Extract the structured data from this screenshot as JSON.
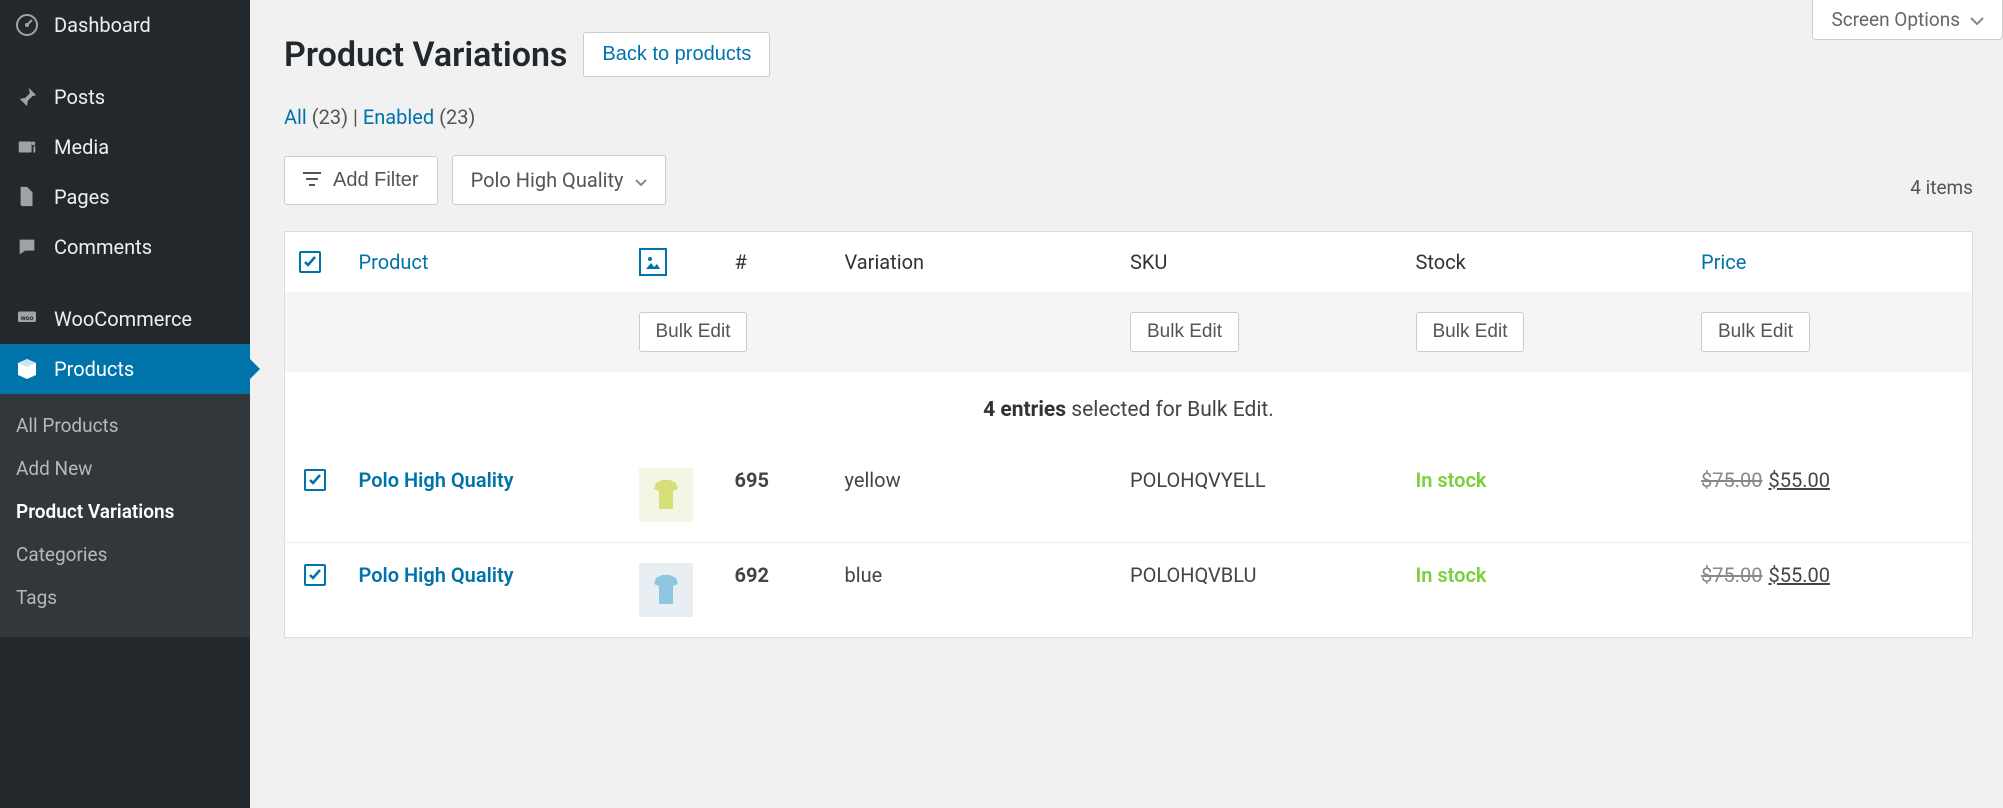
{
  "sidebar": {
    "items": [
      {
        "icon": "dashboard",
        "label": "Dashboard"
      },
      {
        "icon": "pin",
        "label": "Posts"
      },
      {
        "icon": "media",
        "label": "Media"
      },
      {
        "icon": "page",
        "label": "Pages"
      },
      {
        "icon": "comment",
        "label": "Comments"
      },
      {
        "icon": "woo",
        "label": "WooCommerce"
      },
      {
        "icon": "product",
        "label": "Products"
      }
    ],
    "submenu": [
      "All Products",
      "Add New",
      "Product Variations",
      "Categories",
      "Tags"
    ]
  },
  "content": {
    "screen_options": "Screen Options",
    "title": "Product Variations",
    "back_label": "Back to products",
    "subsubsub": {
      "all_label": "All",
      "all_count": "(23)",
      "sep": " | ",
      "enabled_label": "Enabled",
      "enabled_count": "(23)"
    },
    "add_filter": "Add Filter",
    "filter_value": "Polo High Quality",
    "items_count": "4 items",
    "columns": {
      "product": "Product",
      "id": "#",
      "variation": "Variation",
      "sku": "SKU",
      "stock": "Stock",
      "price": "Price"
    },
    "bulk_edit_label": "Bulk Edit",
    "bulk_summary_count": "4 entries",
    "bulk_summary_suffix": " selected for Bulk Edit.",
    "rows": [
      {
        "product": "Polo High Quality",
        "id": "695",
        "variation": "yellow",
        "sku": "POLOHQVYELL",
        "stock": "In stock",
        "price_old": "$75.00",
        "price_new": "$55.00",
        "thumb_bg": "#f2f6e4",
        "shirt_color": "#d7df78"
      },
      {
        "product": "Polo High Quality",
        "id": "692",
        "variation": "blue",
        "sku": "POLOHQVBLU",
        "stock": "In stock",
        "price_old": "$75.00",
        "price_new": "$55.00",
        "thumb_bg": "#e8eef2",
        "shirt_color": "#8fc6e0"
      }
    ]
  }
}
